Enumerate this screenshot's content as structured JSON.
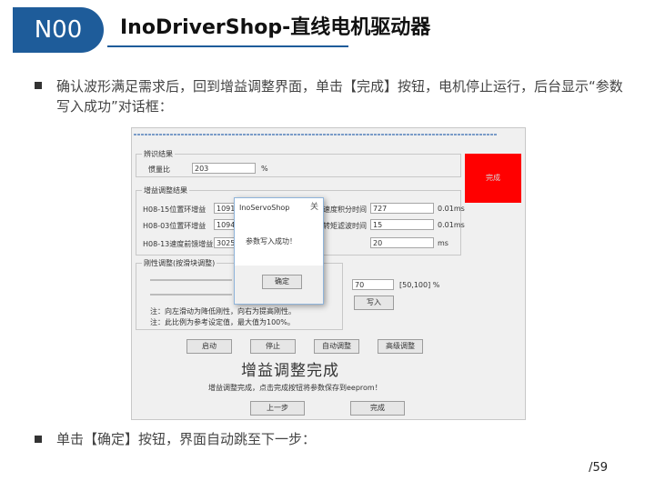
{
  "slide": {
    "badge": "N00",
    "title": "InoDriverShop-直线电机驱动器",
    "para1": "确认波形满足需求后，回到增益调整界面，单击【完成】按钮，电机停止运行，后台显示“参数写入成功”对话框：",
    "para2": "单击【确定】按钮，界面自动跳至下一步：",
    "page": "/59"
  },
  "app": {
    "result_group": "辨识结果",
    "inertia_label": "惯量比",
    "inertia_value": "203",
    "inertia_unit": "%",
    "status_label": "完成",
    "adjust_group": "增益调整结果",
    "rows": [
      {
        "label": "H08-15位置环增益",
        "value": "1091"
      },
      {
        "label": "H08-03位置环增益",
        "value": "1094"
      },
      {
        "label": "H08-13速度前馈增益",
        "value": "3025"
      }
    ],
    "right_rows": [
      {
        "label": "速度积分时间",
        "value": "727",
        "unit": "0.01ms"
      },
      {
        "label": "转矩滤波时间",
        "value": "15",
        "unit": "0.01ms"
      },
      {
        "label": "",
        "value": "20",
        "unit": "ms"
      }
    ],
    "rigidity_group": "刚性调整(按滑块调整)",
    "slider_value": "70",
    "slider_range": "[50,100] %",
    "write_button": "写入",
    "note1": "注：向左滑动为降低刚性，向右为提高刚性。",
    "note2": "注：此比例为参考设定值，最大值为100%。",
    "buttons": [
      "启动",
      "停止",
      "自动调整",
      "高级调整"
    ],
    "banner": "增益调整完成",
    "banner_hint": "增益调整完成，点击完成按钮将参数保存到eeprom！",
    "prev_button": "上一步",
    "finish_button": "完成"
  },
  "dialog": {
    "title": "InoServoShop",
    "close": "关",
    "message": "参数写入成功！",
    "ok": "确定"
  }
}
